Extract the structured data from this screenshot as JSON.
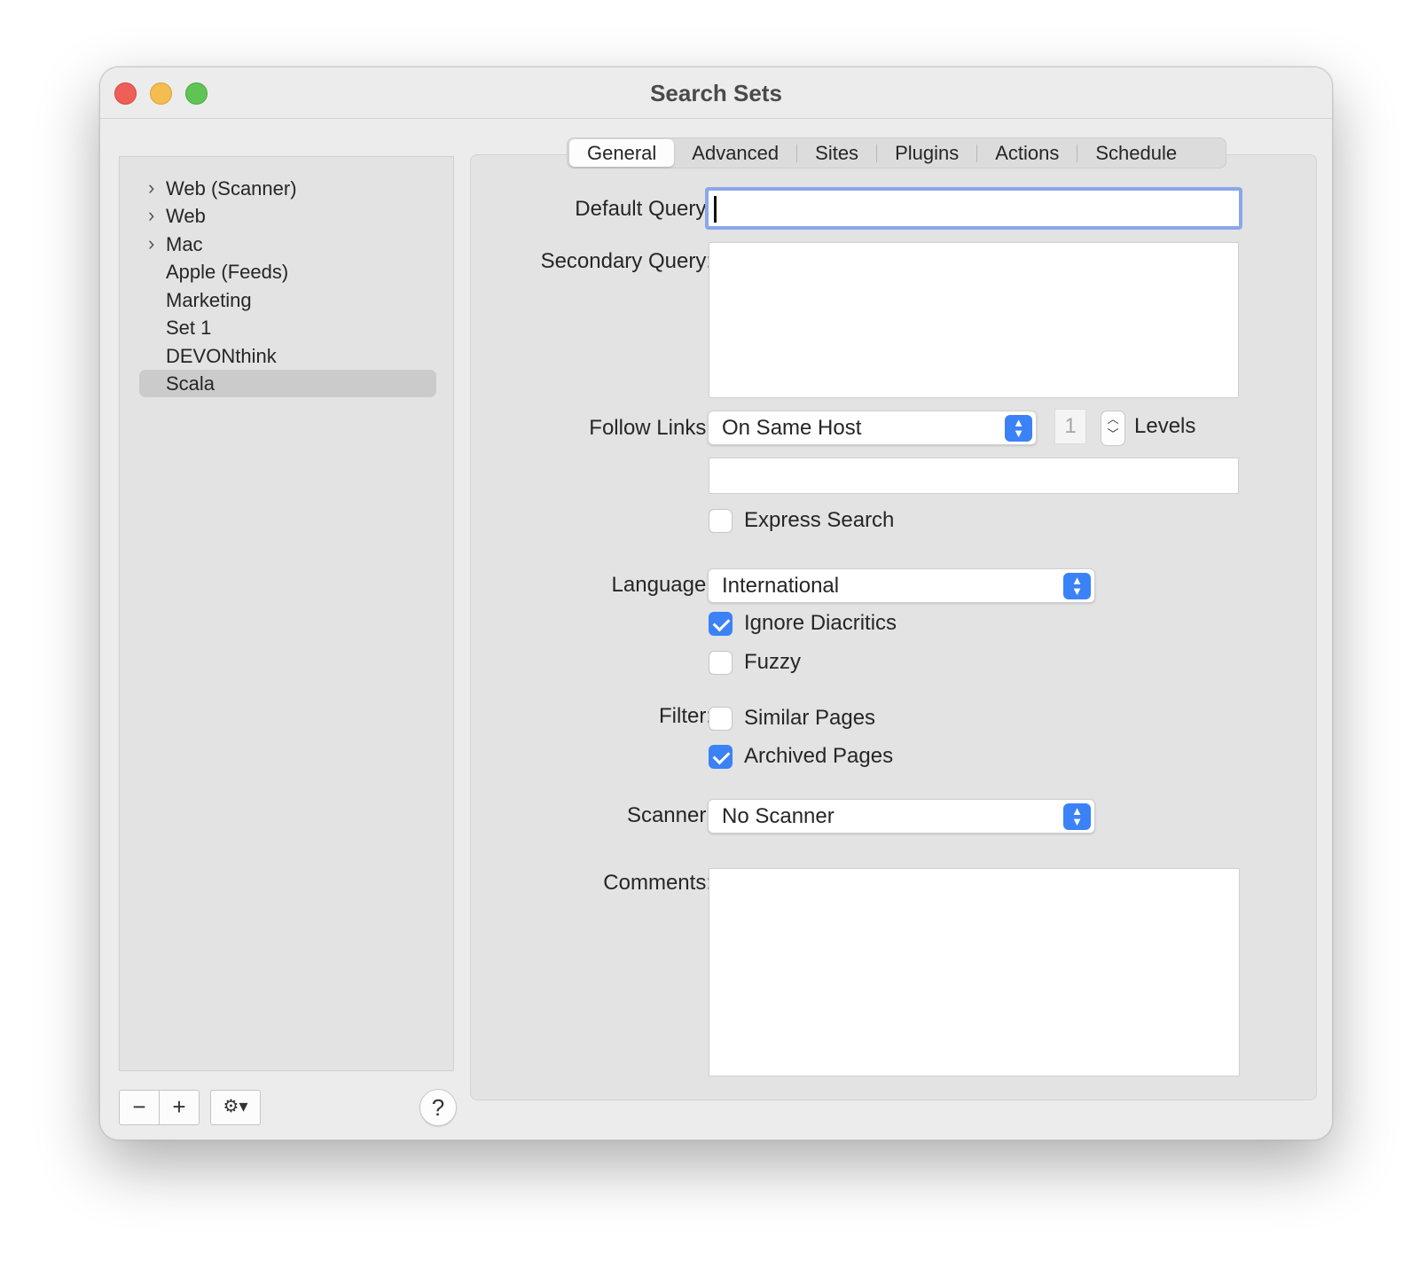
{
  "window": {
    "title": "Search Sets"
  },
  "sidebar": {
    "items": [
      {
        "label": "Web (Scanner)",
        "expandable": true
      },
      {
        "label": "Web",
        "expandable": true
      },
      {
        "label": "Mac",
        "expandable": true
      },
      {
        "label": "Apple (Feeds)",
        "expandable": false
      },
      {
        "label": "Marketing",
        "expandable": false
      },
      {
        "label": "Set 1",
        "expandable": false
      },
      {
        "label": "DEVONthink",
        "expandable": false
      },
      {
        "label": "Scala",
        "expandable": false,
        "selected": true
      }
    ],
    "chevron": "›",
    "buttons": {
      "remove": "−",
      "add": "+",
      "gear": "⚙▾",
      "help": "?"
    }
  },
  "tabs": [
    {
      "label": "General",
      "active": true
    },
    {
      "label": "Advanced"
    },
    {
      "label": "Sites"
    },
    {
      "label": "Plugins"
    },
    {
      "label": "Actions"
    },
    {
      "label": "Schedule"
    }
  ],
  "form": {
    "default_query_label": "Default Query:",
    "default_query_value": "",
    "secondary_query_label": "Secondary Query:",
    "secondary_query_value": "",
    "follow_links_label": "Follow Links:",
    "follow_links_value": "On Same Host",
    "levels_value": "1",
    "levels_label": "Levels",
    "follow_links_filter_value": "",
    "express_search_label": "Express Search",
    "express_search_checked": false,
    "language_label": "Language:",
    "language_value": "International",
    "ignore_diacritics_label": "Ignore Diacritics",
    "ignore_diacritics_checked": true,
    "fuzzy_label": "Fuzzy",
    "fuzzy_checked": false,
    "filter_label": "Filter:",
    "similar_pages_label": "Similar Pages",
    "similar_pages_checked": false,
    "archived_pages_label": "Archived Pages",
    "archived_pages_checked": true,
    "scanner_label": "Scanner:",
    "scanner_value": "No Scanner",
    "comments_label": "Comments:",
    "comments_value": ""
  },
  "colors": {
    "accent": "#3b82f6",
    "focus_ring": "#8aa7ea",
    "close": "#ee5f57",
    "minimize": "#f4bd4f",
    "zoom": "#5fc454"
  }
}
